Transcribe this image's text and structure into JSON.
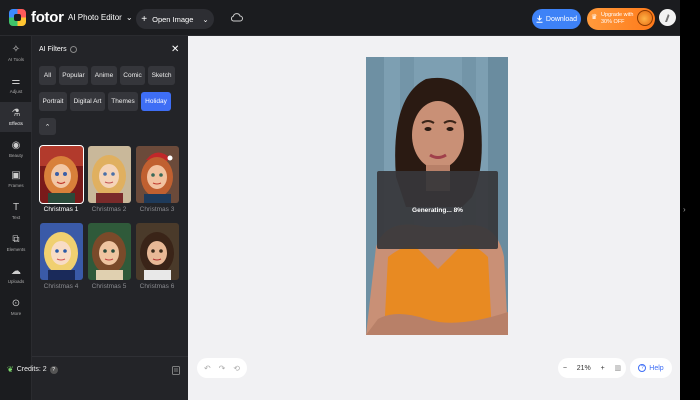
{
  "topbar": {
    "logo_text": "fotor",
    "editor_menu_label": "AI Photo Editor",
    "open_image_label": "Open Image",
    "download_label": "Download",
    "upgrade_line1": "Upgrade with",
    "upgrade_line2": "30% OFF"
  },
  "rail": {
    "items": [
      {
        "label": "AI Tools",
        "icon": "sparkle-icon"
      },
      {
        "label": "Adjust",
        "icon": "sliders-icon"
      },
      {
        "label": "Effects",
        "icon": "flask-icon"
      },
      {
        "label": "Beauty",
        "icon": "eye-icon"
      },
      {
        "label": "Frames",
        "icon": "frame-icon"
      },
      {
        "label": "Text",
        "icon": "text-icon"
      },
      {
        "label": "Elements",
        "icon": "shapes-icon"
      },
      {
        "label": "Uploads",
        "icon": "upload-icon"
      },
      {
        "label": "More",
        "icon": "more-icon"
      }
    ],
    "active": "Effects"
  },
  "panel": {
    "title": "AI Filters",
    "categories_row1": [
      "All",
      "Popular",
      "Anime",
      "Comic",
      "Sketch"
    ],
    "categories_row2": [
      "Portrait",
      "Digital Art",
      "Themes",
      "Holiday"
    ],
    "active_category": "Holiday",
    "filters": [
      "Christmas 1",
      "Christmas 2",
      "Christmas 3",
      "Christmas 4",
      "Christmas 5",
      "Christmas 6"
    ],
    "selected_filter": "Christmas 1",
    "credits_label": "Credits: 2"
  },
  "canvas": {
    "status_text": "Generating... 8%",
    "progress_percent": 8,
    "zoom_label": "21%",
    "help_label": "Help"
  },
  "colors": {
    "accent": "#3e6ef5",
    "download": "#3e82f7",
    "upgrade": "#ff8a2a",
    "panel_bg": "#232428",
    "canvas_bg": "#f1f1f3"
  }
}
